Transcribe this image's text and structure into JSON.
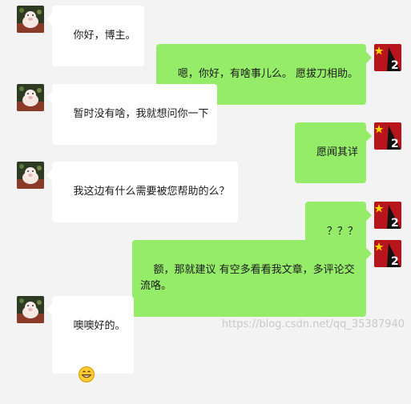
{
  "colors": {
    "background": "#f3f3f3",
    "incoming_bubble": "#ffffff",
    "outgoing_bubble": "#95ec69"
  },
  "chat": {
    "messages": [
      {
        "side": "left",
        "avatar": "pig-avatar",
        "text": "你好，博主。"
      },
      {
        "side": "right",
        "avatar": "flag-avatar",
        "text": "嗯，你好，有啥事儿么。 愿拔刀相助。"
      },
      {
        "side": "left",
        "avatar": "pig-avatar",
        "text": "暂时没有啥，我就想问你一下"
      },
      {
        "side": "right",
        "avatar": "flag-avatar",
        "text": "愿闻其详"
      },
      {
        "side": "left",
        "avatar": "pig-avatar",
        "text": "我这边有什么需要被您帮助的么？"
      },
      {
        "side": "right",
        "avatar": "flag-avatar",
        "text": "？？？"
      },
      {
        "side": "right",
        "avatar": "flag-avatar",
        "text": "额，那就建议 有空多看看我文章，多评论交流咯。"
      },
      {
        "side": "left",
        "avatar": "pig-avatar",
        "text": "噢噢好的。",
        "emoji": "grinning-face-icon"
      }
    ],
    "avatar_badge": "2"
  },
  "watermark": "https://blog.csdn.net/qq_35387940"
}
